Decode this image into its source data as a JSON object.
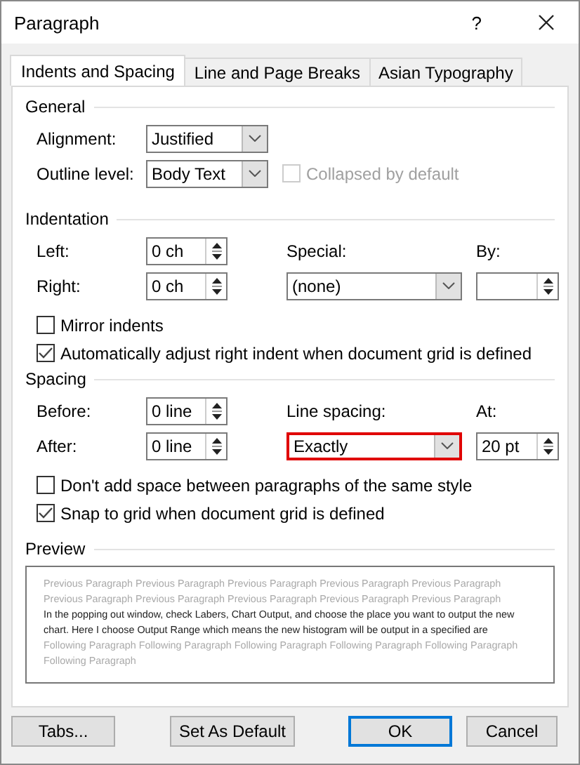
{
  "window": {
    "title": "Paragraph",
    "help": "?"
  },
  "tabs": [
    {
      "label": "Indents and Spacing",
      "selected": true
    },
    {
      "label": "Line and Page Breaks",
      "selected": false
    },
    {
      "label": "Asian Typography",
      "selected": false
    }
  ],
  "general": {
    "heading": "General",
    "alignment": {
      "label": "Alignment:",
      "value": "Justified"
    },
    "outline_level": {
      "label": "Outline level:",
      "value": "Body Text"
    },
    "collapsed": {
      "label": "Collapsed by default",
      "checked": false,
      "disabled": true
    }
  },
  "indentation": {
    "heading": "Indentation",
    "left": {
      "label": "Left:",
      "value": "0 ch"
    },
    "right": {
      "label": "Right:",
      "value": "0 ch"
    },
    "special": {
      "label": "Special:",
      "value": "(none)"
    },
    "by": {
      "label": "By:"
    },
    "mirror": {
      "label": "Mirror indents",
      "checked": false
    },
    "auto_adjust": {
      "label": "Automatically adjust right indent when document grid is defined",
      "checked": true
    }
  },
  "spacing": {
    "heading": "Spacing",
    "before": {
      "label": "Before:",
      "value": "0 line"
    },
    "after": {
      "label": "After:",
      "value": "0 line"
    },
    "line_spacing": {
      "label": "Line spacing:",
      "value": "Exactly",
      "highlighted": true
    },
    "at": {
      "label": "At:",
      "value": "20 pt"
    },
    "dont_add": {
      "label": "Don't add space between paragraphs of the same style",
      "checked": false
    },
    "snap": {
      "label": "Snap to grid when document grid is defined",
      "checked": true
    }
  },
  "preview": {
    "heading": "Preview",
    "previous": "Previous Paragraph Previous Paragraph Previous Paragraph Previous Paragraph Previous Paragraph Previous Paragraph Previous Paragraph Previous Paragraph Previous Paragraph Previous Paragraph",
    "current": "In the popping out window, check Labers, Chart Output,  and choose the place you want to output the new chart. Here I choose Output Range which means the new histogram will be output in a specified are",
    "following": "Following Paragraph Following Paragraph Following Paragraph Following Paragraph Following Paragraph Following Paragraph"
  },
  "buttons": [
    {
      "label": "Tabs...",
      "default": false
    },
    {
      "label": "Set As Default",
      "default": false
    },
    {
      "label": "OK",
      "default": true
    },
    {
      "label": "Cancel",
      "default": false
    }
  ]
}
